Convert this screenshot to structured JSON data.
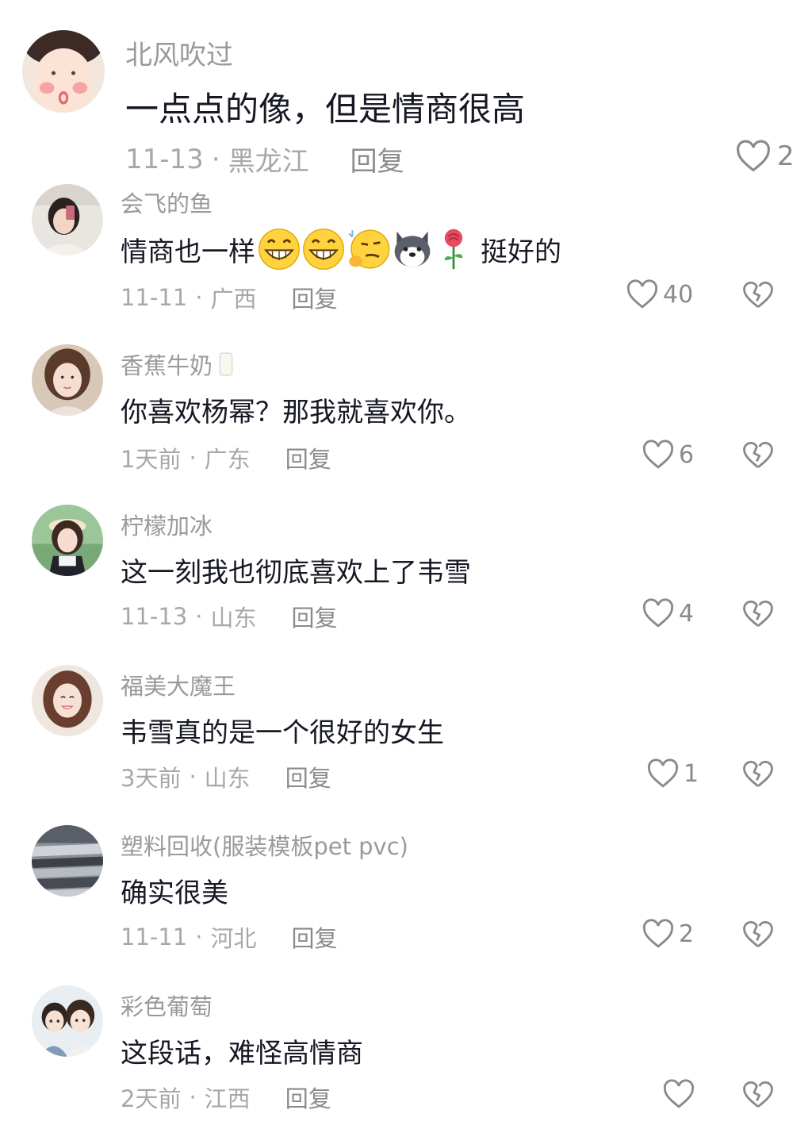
{
  "comments": [
    {
      "username": "北风吹过",
      "text": "一点点的像，但是情商很高",
      "date": "11-13",
      "location": "黑龙江",
      "reply_label": "回复",
      "likes": "2",
      "avatar": "cartoon-face-avatar"
    },
    {
      "username": "会飞的鱼",
      "text": "情商也一样",
      "text_after": "挺好的",
      "emojis": [
        "grin-emoji",
        "grin-emoji",
        "thinking-emoji",
        "husky-emoji",
        "rose-emoji"
      ],
      "date": "11-11",
      "location": "广西",
      "reply_label": "回复",
      "likes": "40",
      "avatar": "selfie-avatar"
    },
    {
      "username": "香蕉牛奶",
      "username_icon": "milk-icon",
      "text": "你喜欢杨幂？那我就喜欢你。",
      "date": "1天前",
      "location": "广东",
      "reply_label": "回复",
      "likes": "6",
      "avatar": "girl-portrait-avatar"
    },
    {
      "username": "柠檬加冰",
      "text": "这一刻我也彻底喜欢上了韦雪",
      "date": "11-13",
      "location": "山东",
      "reply_label": "回复",
      "likes": "4",
      "avatar": "girl-outdoor-avatar"
    },
    {
      "username": "福美大魔王",
      "text": "韦雪真的是一个很好的女生",
      "date": "3天前",
      "location": "山东",
      "reply_label": "回复",
      "likes": "1",
      "avatar": "smiling-girl-avatar"
    },
    {
      "username": "塑料回收(服装模板pet pvc)",
      "text": "确实很美",
      "date": "11-11",
      "location": "河北",
      "reply_label": "回复",
      "likes": "2",
      "avatar": "plastic-pile-avatar"
    },
    {
      "username": "彩色葡萄",
      "text": "这段话，难怪高情商",
      "date": "2天前",
      "location": "江西",
      "reply_label": "回复",
      "likes": "",
      "avatar": "cartoon-couple-avatar"
    }
  ],
  "colors": {
    "username": "#9a9a9a",
    "content": "#161823",
    "meta": "#a8a8a8",
    "icon": "#8a8a8a"
  }
}
